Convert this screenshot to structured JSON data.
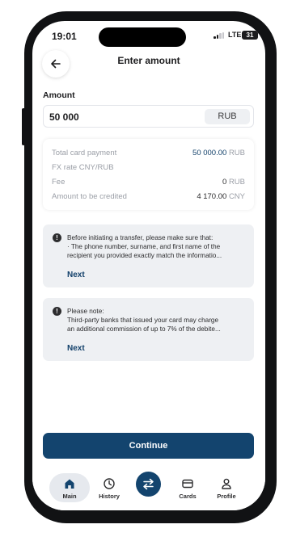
{
  "status_bar": {
    "time": "19:01",
    "network": "LTE",
    "battery": "31"
  },
  "header": {
    "title": "Enter amount"
  },
  "amount": {
    "label": "Amount",
    "value": "50 000",
    "currency": "RUB"
  },
  "details": [
    {
      "key": "Total card payment",
      "value": "50 000.00",
      "unit": "RUB",
      "accent": true
    },
    {
      "key": "FX rate CNY/RUB",
      "value": "",
      "unit": "",
      "accent": false
    },
    {
      "key": "Fee",
      "value": "0",
      "unit": "RUB",
      "accent": false
    },
    {
      "key": "Amount to be credited",
      "value": "4 170.00",
      "unit": "CNY",
      "accent": false
    }
  ],
  "notices": [
    {
      "lines": [
        "Before initiating a transfer, please make sure that:",
        "· The phone number, surname, and first name of the",
        "recipient you provided exactly match the informatio..."
      ],
      "link": "Next"
    },
    {
      "lines": [
        "Please note:",
        "Third-party banks that issued your card may charge",
        "an additional commission of up to 7% of the debite..."
      ],
      "link": "Next"
    }
  ],
  "continue_label": "Continue",
  "tabs": [
    {
      "label": "Main",
      "icon": "home-icon",
      "active": true
    },
    {
      "label": "History",
      "icon": "clock-icon",
      "active": false
    },
    {
      "label": "",
      "icon": "transfer-icon",
      "active": false
    },
    {
      "label": "Cards",
      "icon": "card-icon",
      "active": false
    },
    {
      "label": "Profile",
      "icon": "user-icon",
      "active": false
    }
  ],
  "colors": {
    "primary": "#13446e",
    "accent_text": "#12406a",
    "muted": "#9a9ea6",
    "notice_bg": "#eef0f3"
  }
}
